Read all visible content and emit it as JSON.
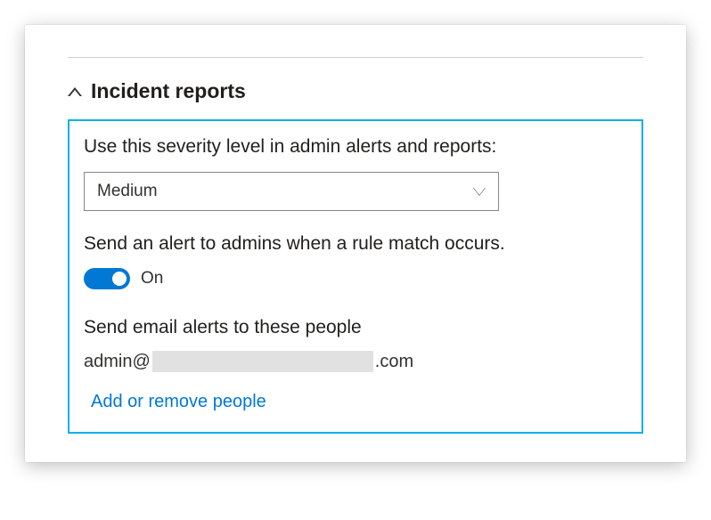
{
  "section": {
    "title": "Incident reports"
  },
  "severity": {
    "label": "Use this severity level in admin alerts and reports:",
    "value": "Medium"
  },
  "alert": {
    "label": "Send an alert to admins when a rule match occurs.",
    "toggle_state": "On"
  },
  "email_alerts": {
    "label": "Send email alerts to these people",
    "prefix": "admin@",
    "suffix": ".com"
  },
  "actions": {
    "add_remove_link": "Add or remove people"
  }
}
